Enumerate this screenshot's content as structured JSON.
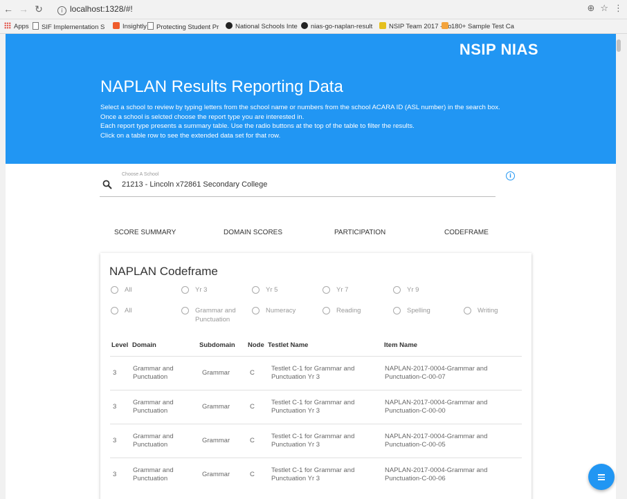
{
  "browser": {
    "url": "localhost:1328/#!",
    "bookmarks": [
      {
        "label": "Apps",
        "icon": "apps-grid-icon",
        "color": "#e04a3f"
      },
      {
        "label": "SIF Implementation S",
        "icon": "page-icon",
        "color": "#777777"
      },
      {
        "label": "Insightly",
        "icon": "insightly-icon",
        "color": "#ef5b2b"
      },
      {
        "label": "Protecting Student Pr",
        "icon": "page-icon",
        "color": "#777777"
      },
      {
        "label": "National Schools Inte",
        "icon": "github-icon",
        "color": "#222222"
      },
      {
        "label": "nias-go-naplan-result",
        "icon": "github-icon",
        "color": "#222222"
      },
      {
        "label": "NSIP Team 2017 - no",
        "icon": "trello-icon",
        "color": "#e5c01e"
      },
      {
        "label": "180+ Sample Test Ca",
        "icon": "bookmark-icon",
        "color": "#f3a33c"
      }
    ]
  },
  "header": {
    "brand": "NSIP NIAS",
    "title": "NAPLAN Results Reporting Data",
    "description": [
      "Select a school to review by typing letters from the school name or numbers from the school ACARA ID (ASL number) in the search box.",
      "Once a school is selcted choose the report type you are interested in.",
      "Each report type presents a summary table. Use the radio buttons at the top of the table to filter the results.",
      "Click on a table row to see the extended data set for that row."
    ],
    "bg_color": "#2196f3"
  },
  "search": {
    "label": "Choose A School",
    "value": "21213 - Lincoln x72861 Secondary College"
  },
  "tabs": [
    "SCORE SUMMARY",
    "DOMAIN SCORES",
    "PARTICIPATION",
    "CODEFRAME"
  ],
  "card": {
    "title": "NAPLAN Codeframe",
    "year_filters": [
      "All",
      "Yr 3",
      "Yr 5",
      "Yr 7",
      "Yr 9"
    ],
    "domain_filters": [
      "All",
      "Grammar and Punctuation",
      "Numeracy",
      "Reading",
      "Spelling",
      "Writing"
    ],
    "columns": [
      "Level",
      "Domain",
      "Subdomain",
      "Node",
      "Testlet Name",
      "Item Name"
    ],
    "rows": [
      {
        "level": "3",
        "domain": "Grammar and Punctuation",
        "subdomain": "Grammar",
        "node": "C",
        "testlet": "Testlet C-1 for Grammar and Punctuation Yr 3",
        "item": "NAPLAN-2017-0004-Grammar and Punctuation-C-00-07"
      },
      {
        "level": "3",
        "domain": "Grammar and Punctuation",
        "subdomain": "Grammar",
        "node": "C",
        "testlet": "Testlet C-1 for Grammar and Punctuation Yr 3",
        "item": "NAPLAN-2017-0004-Grammar and Punctuation-C-00-00"
      },
      {
        "level": "3",
        "domain": "Grammar and Punctuation",
        "subdomain": "Grammar",
        "node": "C",
        "testlet": "Testlet C-1 for Grammar and Punctuation Yr 3",
        "item": "NAPLAN-2017-0004-Grammar and Punctuation-C-00-05"
      },
      {
        "level": "3",
        "domain": "Grammar and Punctuation",
        "subdomain": "Grammar",
        "node": "C",
        "testlet": "Testlet C-1 for Grammar and Punctuation Yr 3",
        "item": "NAPLAN-2017-0004-Grammar and Punctuation-C-00-06"
      }
    ]
  }
}
